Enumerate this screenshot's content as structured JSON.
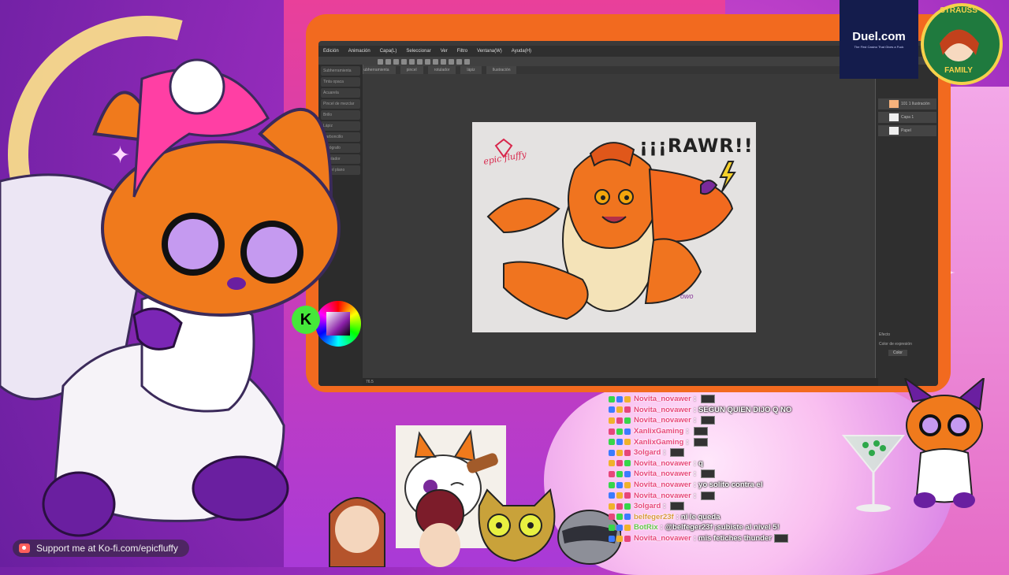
{
  "app": {
    "menu": [
      "Edición",
      "Animación",
      "Capa(L)",
      "Seleccionar",
      "Ver",
      "Filtro",
      "Ventana(W)",
      "Ayuda(H)"
    ],
    "tabs": [
      "Subherramienta",
      "pincel",
      "rotulador",
      "lápiz",
      "Ilustración"
    ],
    "brushes": [
      "Subherramienta",
      "Tinta opaca",
      "Acuarela",
      "Pincel de mezclar",
      "Brillo",
      "Lápiz",
      "Carboncillo",
      "Aerógrafo",
      "Rotulador",
      "Pincel plano"
    ],
    "layers": [
      {
        "name": "101 1 Ilustración",
        "thumb": "sketch"
      },
      {
        "name": "Capa 1",
        "thumb": "white"
      },
      {
        "name": "Papel",
        "thumb": "white"
      }
    ],
    "right_bottom_labels": [
      "Efecto",
      "Color de expresión",
      "Color"
    ],
    "status_zoom": "76.5"
  },
  "artwork": {
    "shout": "¡¡¡RAWR!!!",
    "signature": "epic fluffy",
    "owo": "owo"
  },
  "sponsor": {
    "name": "Duel.com",
    "tagline": "The First Casino That Gives a Fuck"
  },
  "badge": {
    "top": "STRAUSS",
    "bottom": "FAMILY"
  },
  "chat": [
    {
      "user": "Novita_novawer",
      "msg": "",
      "emote": true,
      "color": "#e7467a"
    },
    {
      "user": "Novita_novawer",
      "msg": "SEGUN QUIEN DIJO Q NO",
      "emote": false,
      "color": "#e7467a"
    },
    {
      "user": "Novita_novawer",
      "msg": "",
      "emote": true,
      "color": "#e7467a"
    },
    {
      "user": "XanlixGaming",
      "msg": "",
      "emote": true,
      "color": "#e7467a"
    },
    {
      "user": "XanlixGaming",
      "msg": "",
      "emote": true,
      "color": "#e7467a"
    },
    {
      "user": "3olgard",
      "msg": "",
      "emote": true,
      "color": "#e7467a"
    },
    {
      "user": "Novita_novawer",
      "msg": "q",
      "emote": false,
      "color": "#e7467a"
    },
    {
      "user": "Novita_novawer",
      "msg": "",
      "emote": true,
      "color": "#e7467a"
    },
    {
      "user": "Novita_novawer",
      "msg": "yo solito contra el",
      "emote": false,
      "color": "#e7467a"
    },
    {
      "user": "Novita_novawer",
      "msg": "",
      "emote": true,
      "color": "#e7467a"
    },
    {
      "user": "3olgard",
      "msg": "",
      "emote": true,
      "color": "#e7467a"
    },
    {
      "user": "belfeger23f",
      "msg": "ni le queda",
      "emote": false,
      "color": "#d89a3c"
    },
    {
      "user": "BotRix",
      "msg": "@belfeger23f ¡subiste al nivel 5!",
      "emote": false,
      "color": "#63c64a"
    },
    {
      "user": "Novita_novawer",
      "msg": "mis fetiches thunder",
      "emote": true,
      "color": "#e7467a"
    }
  ],
  "kofi": {
    "text": "Support me at Ko-fi.com/epicfluffy",
    "icon": "ko-fi-cup-icon"
  },
  "colors": {
    "accent_orange": "#f26a1f",
    "bg_purple": "#9b2dbf",
    "chat_pink": "#e7467a"
  }
}
